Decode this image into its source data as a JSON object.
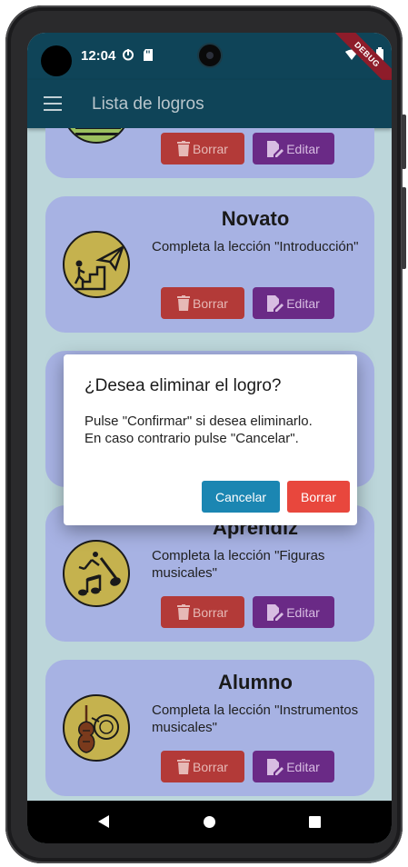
{
  "status_bar": {
    "time": "12:04",
    "debug_label": "DEBUG"
  },
  "app_bar": {
    "title": "Lista de logros",
    "menu_icon": "menu-icon"
  },
  "colors": {
    "app_bar": "#0f4458",
    "card": "#a7b2e3",
    "delete_button": "#b33a38",
    "edit_button": "#6a2a86",
    "dialog_cancel": "#1b86b2",
    "dialog_delete": "#e8473d"
  },
  "achievements": [
    {
      "title": "",
      "description": "",
      "badge_icon": "partial-badge-icon",
      "delete_label": "Borrar",
      "edit_label": "Editar"
    },
    {
      "title": "Novato",
      "description": "Completa la lección \"Introducción\"",
      "badge_icon": "stairs-paper-plane-icon",
      "delete_label": "Borrar",
      "edit_label": "Editar"
    },
    {
      "title": "",
      "description": "",
      "badge_icon": "",
      "delete_label": "",
      "edit_label": ""
    },
    {
      "title": "Aprendiz",
      "description": "Completa la lección \"Figuras musicales\"",
      "badge_icon": "music-notes-icon",
      "delete_label": "Borrar",
      "edit_label": "Editar"
    },
    {
      "title": "Alumno",
      "description": "Completa la lección \"Instrumentos musicales\"",
      "badge_icon": "violin-horn-icon",
      "delete_label": "Borrar",
      "edit_label": "Editar"
    }
  ],
  "dialog": {
    "title": "¿Desea eliminar el logro?",
    "message_line1": "Pulse \"Confirmar\" si desea eliminarlo.",
    "message_line2": "En caso contrario pulse \"Cancelar\".",
    "cancel_label": "Cancelar",
    "confirm_label": "Borrar"
  },
  "nav_bar": {
    "back_icon": "back-triangle-icon",
    "home_icon": "home-circle-icon",
    "recents_icon": "recents-square-icon"
  }
}
